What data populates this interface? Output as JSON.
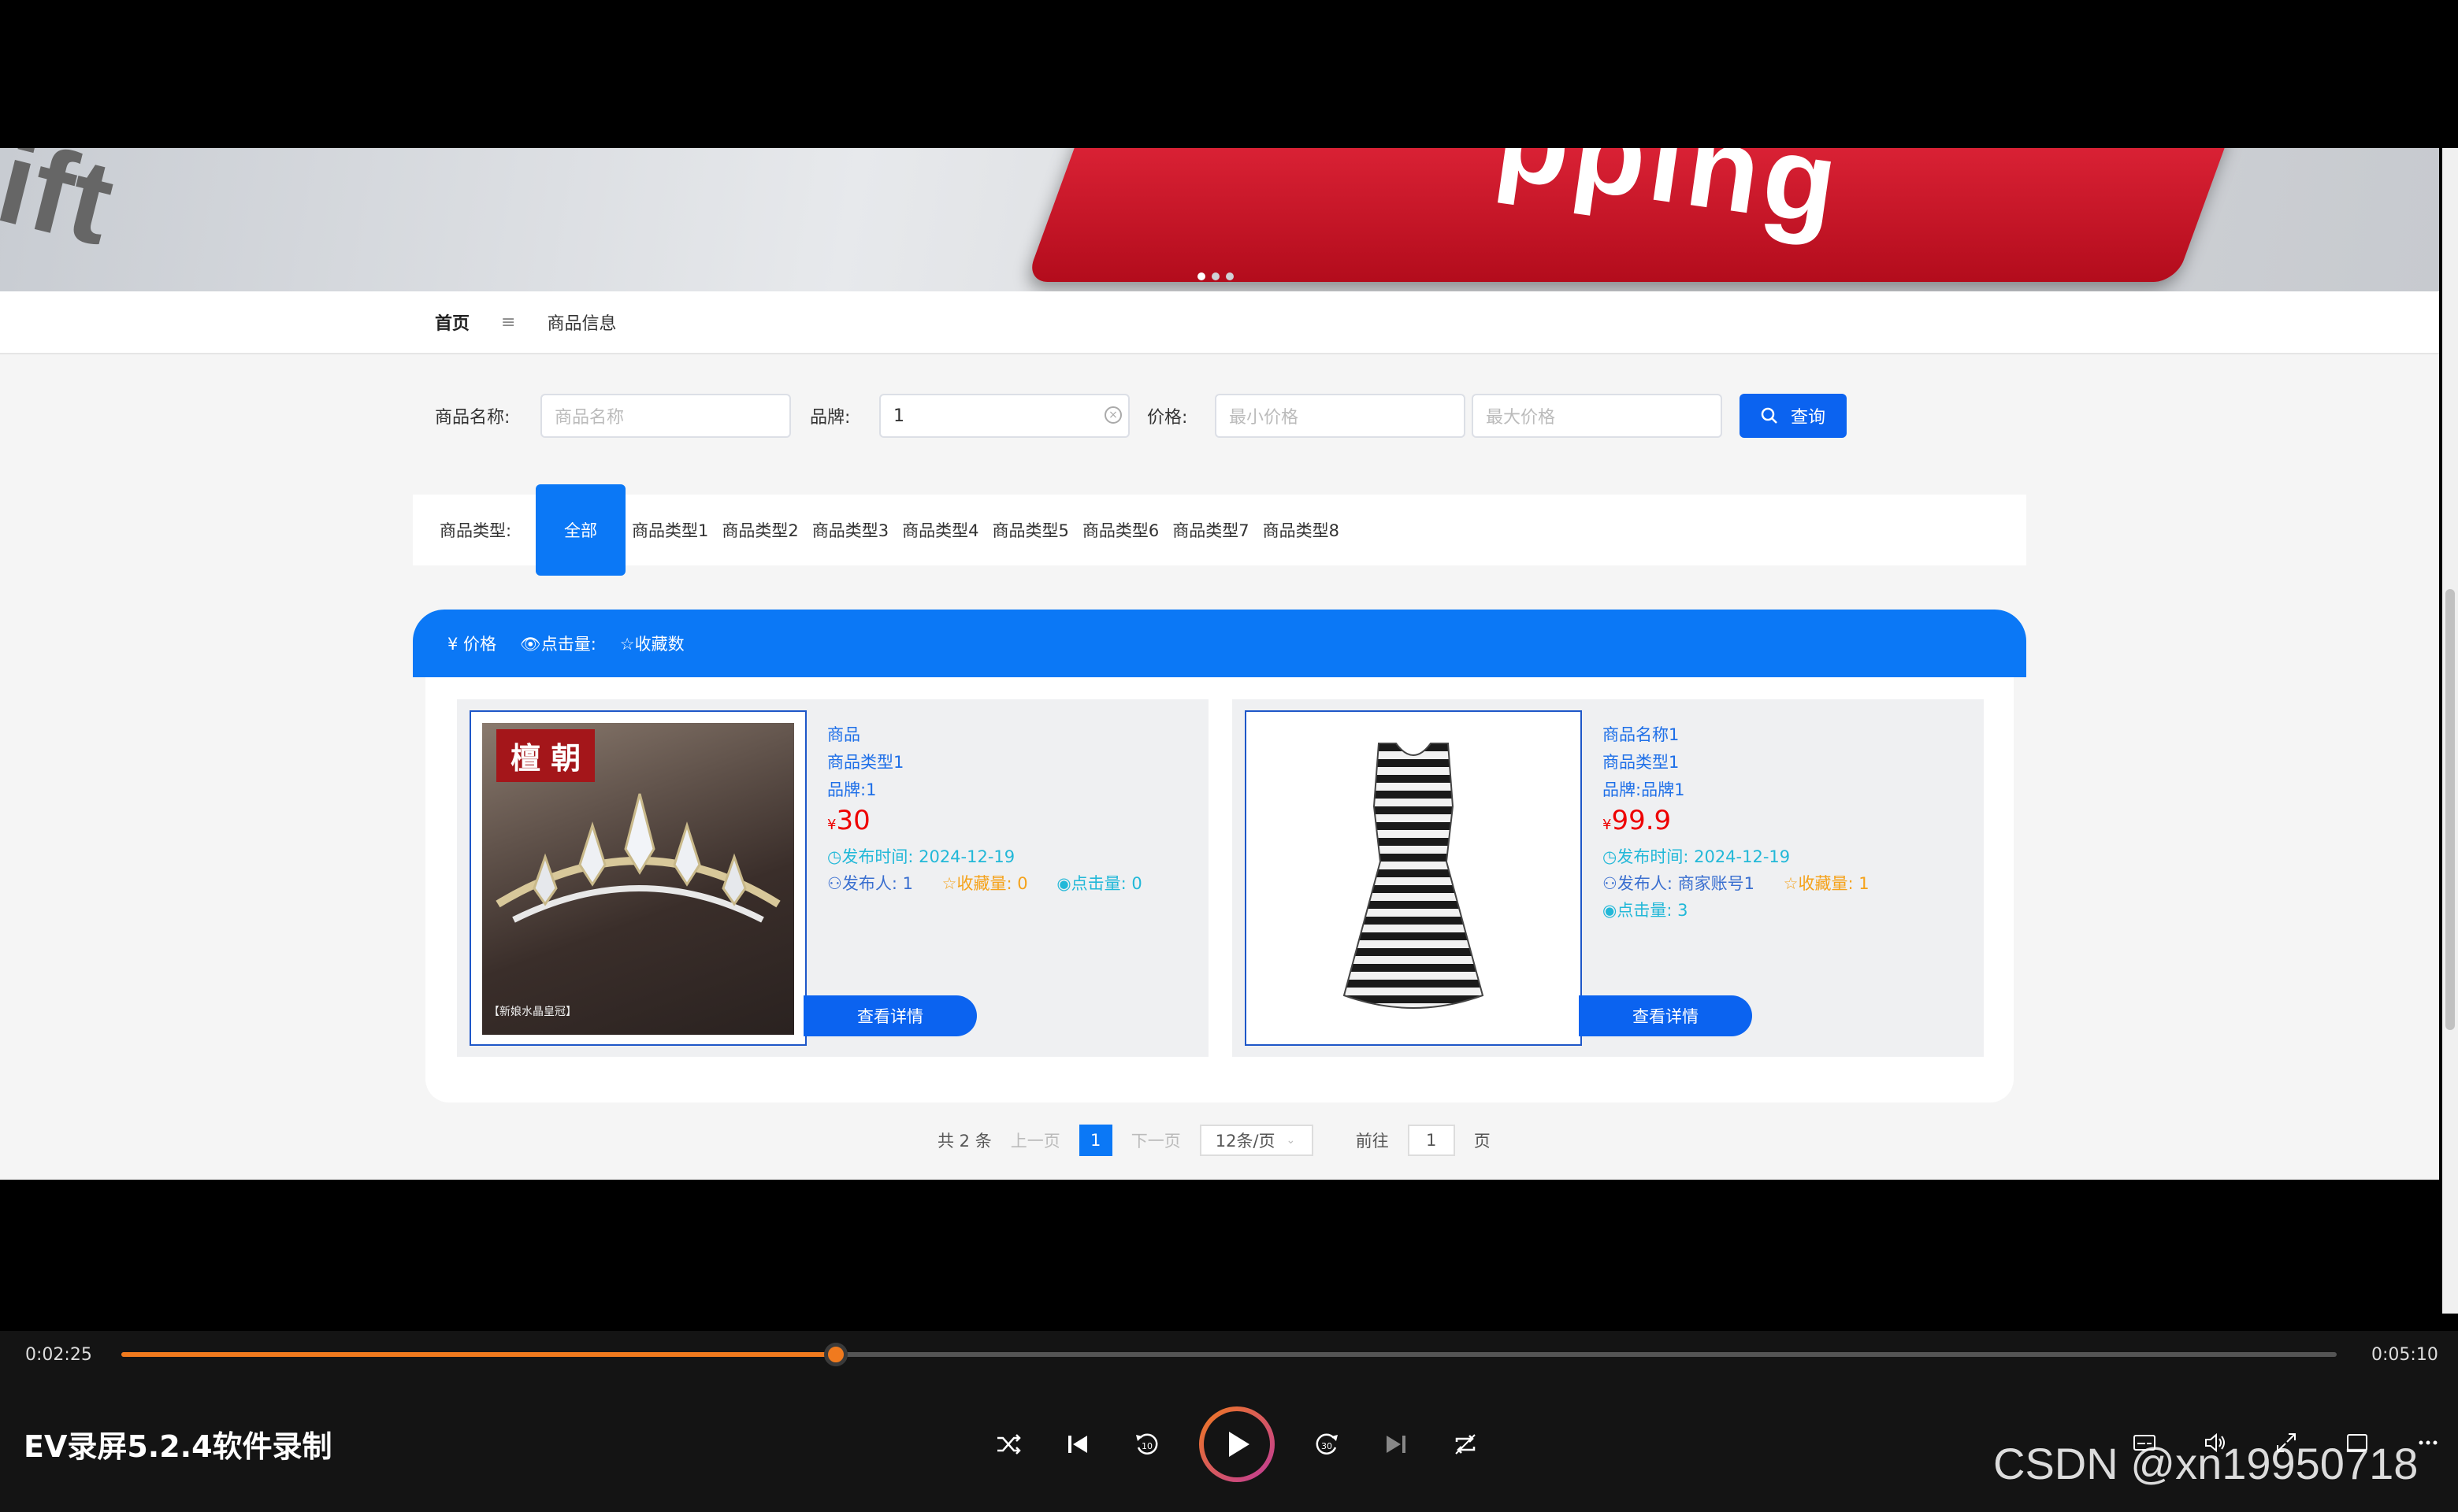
{
  "banner": {
    "word": "pping",
    "word_left": "ift"
  },
  "nav": {
    "home": "首页",
    "separator": "≡",
    "current": "商品信息"
  },
  "filters": {
    "name_label": "商品名称:",
    "name_placeholder": "商品名称",
    "brand_label": "品牌:",
    "brand_value": "1",
    "price_label": "价格:",
    "min_placeholder": "最小价格",
    "max_placeholder": "最大价格",
    "search_label": "查询"
  },
  "types": {
    "label": "商品类型:",
    "all": "全部",
    "items": [
      "商品类型1",
      "商品类型2",
      "商品类型3",
      "商品类型4",
      "商品类型5",
      "商品类型6",
      "商品类型7",
      "商品类型8"
    ]
  },
  "sort": {
    "price": "¥ 价格",
    "clicks": "点击量:",
    "favorites": "收藏数"
  },
  "products": [
    {
      "name": "商品",
      "type": "商品类型1",
      "brand": "品牌:1",
      "price_symbol": "¥",
      "price": "30",
      "time_label": "发布时间:",
      "time": "2024-12-19",
      "publisher_label": "发布人:",
      "publisher": "1",
      "fav_label": "收藏量:",
      "fav": "0",
      "click_label": "点击量:",
      "click": "0",
      "detail": "查看详情",
      "image_text": "檀 朝",
      "image_caption": "【新娘水晶皇冠】"
    },
    {
      "name": "商品名称1",
      "type": "商品类型1",
      "brand": "品牌:品牌1",
      "price_symbol": "¥",
      "price": "99.9",
      "time_label": "发布时间:",
      "time": "2024-12-19",
      "publisher_label": "发布人:",
      "publisher": "商家账号1",
      "fav_label": "收藏量:",
      "fav": "1",
      "click_label": "点击量:",
      "click": "3",
      "detail": "查看详情"
    }
  ],
  "pager": {
    "total": "共 2 条",
    "prev": "上一页",
    "page": "1",
    "next": "下一页",
    "size": "12条/页",
    "goto": "前往",
    "goto_value": "1",
    "page_unit": "页"
  },
  "player": {
    "current_time": "0:02:25",
    "total_time": "0:05:10",
    "progress": 0.3226,
    "title": "EV录屏5.2.4软件录制",
    "accent": "#f07a1e"
  },
  "watermark": "CSDN @xn19950718"
}
